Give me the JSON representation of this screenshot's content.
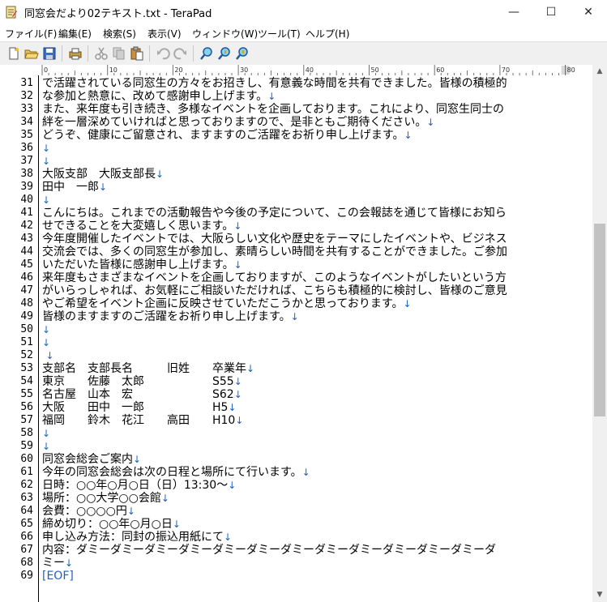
{
  "window": {
    "title": "同窓会だより02テキスト.txt - TeraPad",
    "minimize": "—",
    "maximize": "☐",
    "close": "✕"
  },
  "menu": [
    {
      "label": "ファイル(F)"
    },
    {
      "label": "編集(E)"
    },
    {
      "label": "検索(S)"
    },
    {
      "label": "表示(V)"
    },
    {
      "label": "ウィンドウ(W)"
    },
    {
      "label": "ツール(T)"
    },
    {
      "label": "ヘルプ(H)"
    }
  ],
  "toolbar": {
    "icons": [
      "new-file-icon",
      "open-folder-icon",
      "save-icon",
      "print-icon",
      "cut-icon",
      "copy-icon",
      "paste-icon",
      "undo-icon",
      "redo-icon",
      "search-icon",
      "search-prev-icon",
      "search-next-icon"
    ]
  },
  "ruler": {
    "marks": [
      "0",
      "10",
      "20",
      "30",
      "40",
      "50",
      "60",
      "70",
      "80"
    ]
  },
  "colors": {
    "newline_marker": "#2060c0",
    "eof_marker": "#2060c0"
  },
  "editor": {
    "lines": [
      {
        "num": "31",
        "text": "で活躍されている同窓生の方々をお招きし、有意義な時間を共有できました。皆様の積極的",
        "nl": ""
      },
      {
        "num": "32",
        "text": "な参加と熱意に、改めて感謝申し上げます。",
        "nl": "↓"
      },
      {
        "num": "33",
        "text": "また、来年度も引き続き、多様なイベントを企画しております。これにより、同窓生同士の",
        "nl": ""
      },
      {
        "num": "34",
        "text": "絆を一層深めていければと思っておりますので、是非ともご期待ください。",
        "nl": "↓"
      },
      {
        "num": "35",
        "text": "どうぞ、健康にご留意され、ますますのご活躍をお祈り申し上げます。",
        "nl": "↓"
      },
      {
        "num": "36",
        "text": "",
        "nl": "↓"
      },
      {
        "num": "37",
        "text": "",
        "nl": "↓"
      },
      {
        "num": "38",
        "text": "大阪支部　大阪支部長",
        "nl": "↓"
      },
      {
        "num": "39",
        "text": "田中　一郎",
        "nl": "↓"
      },
      {
        "num": "40",
        "text": "",
        "nl": "↓"
      },
      {
        "num": "41",
        "text": "こんにちは。これまでの活動報告や今後の予定について、この会報誌を通じて皆様にお知ら",
        "nl": ""
      },
      {
        "num": "42",
        "text": "せできることを大変嬉しく思います。",
        "nl": "↓"
      },
      {
        "num": "43",
        "text": "今年度開催したイベントでは、大阪らしい文化や歴史をテーマにしたイベントや、ビジネス",
        "nl": ""
      },
      {
        "num": "44",
        "text": "交流会では、多くの同窓生が参加し、素晴らしい時間を共有することができました。ご参加",
        "nl": ""
      },
      {
        "num": "45",
        "text": "いただいた皆様に感謝申し上げます。",
        "nl": "↓"
      },
      {
        "num": "46",
        "text": "来年度もさまざまなイベントを企画しておりますが、このようなイベントがしたいという方",
        "nl": ""
      },
      {
        "num": "47",
        "text": "がいらっしゃれば、お気軽にご相談いただければ、こちらも積極的に検討し、皆様のご意見",
        "nl": ""
      },
      {
        "num": "48",
        "text": "やご希望をイベント企画に反映させていただこうかと思っております。",
        "nl": "↓"
      },
      {
        "num": "49",
        "text": "皆様のますますのご活躍をお祈り申し上げます。",
        "nl": "↓"
      },
      {
        "num": "50",
        "text": "",
        "nl": "↓"
      },
      {
        "num": "51",
        "text": "",
        "nl": "↓"
      },
      {
        "num": "52",
        "text": " ",
        "nl": "↓"
      },
      {
        "num": "53",
        "text": "支部名　支部長名　　　旧姓　　卒業年",
        "nl": "↓"
      },
      {
        "num": "54",
        "text": "東京　　佐藤　太郎　　　　　　S55",
        "nl": "↓"
      },
      {
        "num": "55",
        "text": "名古屋　山本　宏　　　　　　　S62",
        "nl": "↓"
      },
      {
        "num": "56",
        "text": "大阪　　田中　一郎　　　　　　H5",
        "nl": "↓"
      },
      {
        "num": "57",
        "text": "福岡　　鈴木　花江　　高田　　H10",
        "nl": "↓"
      },
      {
        "num": "58",
        "text": "",
        "nl": "↓"
      },
      {
        "num": "59",
        "text": "",
        "nl": "↓"
      },
      {
        "num": "60",
        "text": "同窓会総会ご案内",
        "nl": "↓"
      },
      {
        "num": "61",
        "text": "今年の同窓会総会は次の日程と場所にて行います。",
        "nl": "↓"
      },
      {
        "num": "62",
        "text": "日時：○○年○月○日（日）13:30〜",
        "nl": "↓"
      },
      {
        "num": "63",
        "text": "場所：○○大学○○会館",
        "nl": "↓"
      },
      {
        "num": "64",
        "text": "会費：○○○○円",
        "nl": "↓"
      },
      {
        "num": "65",
        "text": "締め切り：○○年○月○日",
        "nl": "↓"
      },
      {
        "num": "66",
        "text": "申し込み方法：同封の振込用紙にて",
        "nl": "↓"
      },
      {
        "num": "67",
        "text": "内容：ダミーダミーダミーダミーダミーダミーダミーダミーダミーダミーダミーダミーダ",
        "nl": ""
      },
      {
        "num": "68",
        "text": "ミー",
        "nl": "↓"
      },
      {
        "num": "69",
        "text": "",
        "nl": "",
        "eof": "[EOF]"
      }
    ]
  }
}
